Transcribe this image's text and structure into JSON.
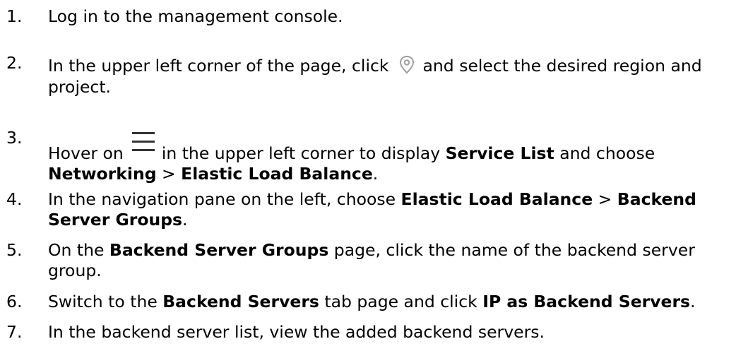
{
  "steps": [
    {
      "num": "1.",
      "segments": [
        "Log in to the management console."
      ]
    },
    {
      "num": "2.",
      "segments": [
        "In the upper left corner of the page, click",
        "and select the desired region and project."
      ],
      "icon": "location-pin-icon"
    },
    {
      "num": "3.",
      "segments": [
        "Hover on",
        "in the upper left corner to display ",
        "Service List",
        " and choose ",
        "Networking",
        " > ",
        "Elastic Load Balance",
        "."
      ],
      "icon": "hamburger-menu-icon"
    },
    {
      "num": "4.",
      "segments": [
        "In the navigation pane on the left, choose ",
        "Elastic Load Balance",
        " > ",
        "Backend Server Groups",
        "."
      ]
    },
    {
      "num": "5.",
      "segments": [
        "On the ",
        "Backend Server Groups",
        " page, click the name of the backend server group."
      ]
    },
    {
      "num": "6.",
      "segments": [
        "Switch to the ",
        "Backend Servers",
        " tab page and click ",
        "IP as Backend Servers",
        "."
      ]
    },
    {
      "num": "7.",
      "segments": [
        "In the backend server list, view the added backend servers."
      ]
    }
  ],
  "colors": {
    "text": "#000000",
    "icon": "#9e9e9e",
    "menu_icon": "#333333"
  }
}
